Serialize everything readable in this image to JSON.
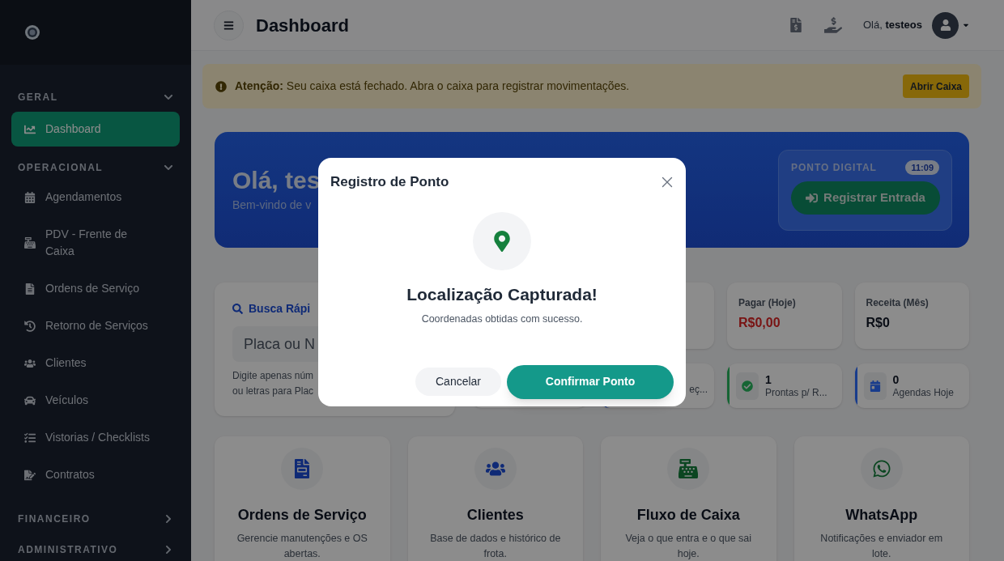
{
  "sidebar": {
    "sections": [
      {
        "title": "GERAL",
        "expanded": true,
        "items": [
          {
            "label": "Dashboard",
            "selected": true
          }
        ]
      },
      {
        "title": "OPERACIONAL",
        "expanded": true,
        "items": [
          {
            "label": "Agendamentos",
            "selected": false
          },
          {
            "label": "PDV - Frente de Caixa",
            "selected": false
          },
          {
            "label": "Ordens de Serviço",
            "selected": false
          },
          {
            "label": "Retorno de Serviços",
            "selected": false
          },
          {
            "label": "Clientes",
            "selected": false
          },
          {
            "label": "Veículos",
            "selected": false
          },
          {
            "label": "Vistorias / Checklists",
            "selected": false
          },
          {
            "label": "Contratos",
            "selected": false
          }
        ]
      },
      {
        "title": "FINANCEIRO",
        "expanded": false
      },
      {
        "title": "ADMINISTRATIVO",
        "expanded": false
      }
    ]
  },
  "header": {
    "title": "Dashboard",
    "greeting": "Olá,",
    "user": "testeos"
  },
  "alert": {
    "label": "Atenção:",
    "message": "Seu caixa está fechado. Abra o caixa para registrar movimentações.",
    "button": "Abrir Caixa"
  },
  "hero": {
    "title": "Olá, tes",
    "subtitle": "Bem-vindo de v",
    "ponto": {
      "label": "PONTO DIGITAL",
      "time": "11:09",
      "button": "Registrar Entrada"
    }
  },
  "search": {
    "title": "Busca Rápi",
    "placeholder": "Placa ou N",
    "hint": [
      "Digite apenas núm",
      "ou letras para Plac"
    ]
  },
  "stats_top": [
    {
      "kind": "covered"
    },
    {
      "kind": "money",
      "label": "Pagar (Hoje)",
      "value": "R$0,00",
      "negative": true
    },
    {
      "kind": "money",
      "label": "Receita (Mês)",
      "value": "R$0",
      "negative": false
    }
  ],
  "stats_bottom": [
    {
      "kind": "covered"
    },
    {
      "kind": "partial",
      "label": "eç..."
    },
    {
      "kind": "status",
      "value": "1",
      "label": "Prontas p/ R...",
      "color": "#166534"
    },
    {
      "kind": "status",
      "value": "0",
      "label": "Agendas Hoje",
      "color": "#183c8c"
    }
  ],
  "features": [
    {
      "title": "Ordens de Serviço",
      "description": "Gerencie manutenções e OS abertas."
    },
    {
      "title": "Clientes",
      "description": "Base de dados e histórico de frota."
    },
    {
      "title": "Fluxo de Caixa",
      "description": "Veja o que entra e o que sai hoje."
    },
    {
      "title": "WhatsApp",
      "description": "Notificações e enviador em lote."
    }
  ],
  "modal": {
    "title": "Registro de Ponto",
    "heading": "Localização Capturada!",
    "message": "Coordenadas obtidas com sucesso.",
    "cancel": "Cancelar",
    "confirm": "Confirmar Ponto"
  }
}
